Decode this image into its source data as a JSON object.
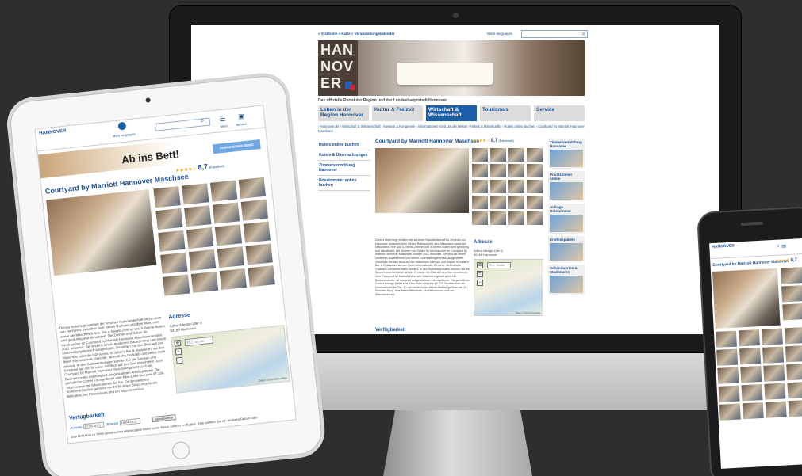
{
  "site": {
    "nav_links": "» Startseite  » Karte  » Veranstaltungskalender",
    "languages": "More languages",
    "logo_word": "HANNOVER",
    "tagline": "Das offizielle Portal der Region und der Landeshauptstadt Hannover",
    "menu": [
      {
        "label": "Leben in der Region Hannover",
        "active": false
      },
      {
        "label": "Kultur & Freizeit",
        "active": false
      },
      {
        "label": "Wirtschaft & Wissenschaft",
        "active": true
      },
      {
        "label": "Tourismus",
        "active": false
      },
      {
        "label": "Service",
        "active": false
      }
    ],
    "breadcrumb": "› Hannover.de  › Wirtschaft & Wissenschaft  › Messen & Kongresse  › Informationen rund um die Messe  › Hotels & Unterkünfte  › Hotels online buchen  › Courtyard by Marriott Hannover Maschsee",
    "sidebar": [
      "Hotels online buchen",
      "Hotels & Übernachtungen",
      "Zimmervermittlung Hannover",
      "Privatzimmer online buchen"
    ],
    "hotel_title": "Courtyard by Marriott Hannover Maschsee",
    "rating_stars": "★★★★☆",
    "rating_score": "8,7",
    "rating_note": "(Fabelhaft)",
    "description": "Dieses Hotel liegt inmitten der schönen Naturlandschaft im Zentrum von Hannover, zwischen dem Neuen Rathaus und dem Maschsee sowie am Maschteich-See. Die 4-Sterne-Zimmer und 5-Sterne-Suiten sind geräumig und klimatisiert. Die Zimmer und Suiten für Nichtraucher im Courtyard by Marriott Hannover Maschsee wurden 2012 renoviert. Sie sind mit einem modernen Badezimmer und einem Unterhaltungsbereich ausgestattet. Genießen Sie den Blick auf den Maschsee oder die HDI-Arena. In Julian's Bar & Restaurant werden Ihnen internationale Gerichte, farbenfrohe Cocktails und vieles mehr serviert. In den Sommermonaten können Sie die Speisen und Getränke auf der Terrasse mit Blick auf den See einnehmen. Zum Courtyard by Marriott Hannover Maschsee gehört auch ein Businesscenter mit komplett ausgestatteten Arbeitsplätzen. Die gemütliche Corner Lounge bietet eine Kino-Ecke und eine 67-Zoll-Touchscreen mit Informationen für Sie. Zu den weiteren Annehmlichkeiten gehören ein 24-Stunden-Shop, eine kleine Bibliothek, ein Fitnessraum und ein Wäscheservice.",
    "address_title": "Adresse",
    "address_line1": "Arthur-Menge-Ufer 3",
    "address_line2": "30169 Hannover",
    "map_search_placeholder": "PLZ, Straße",
    "map_credit": "Daten ©OpenStreetMap",
    "availability_title": "Verfügbarkeit",
    "right_boxes": [
      "Zimmervermittlung Hannover",
      "Privatzimmer online",
      "Anfrage Hotelzimmer",
      "Erlebnispakete",
      "Sehenswertes & Stadttouren"
    ]
  },
  "tablet": {
    "logo": "HANNOVER",
    "languages": "More languages",
    "menu_label": "Menü",
    "user_label": "Service",
    "banner_text": "Ab ins Bett!",
    "banner_button": "HANNOVERERLEBNIS",
    "hotel_title": "Courtyard by Marriott Hannover Maschsee",
    "rating_stars": "★★★★☆",
    "rating_score": "8,7",
    "rating_note": "(Fabelhaft)",
    "description": "Dieses Hotel liegt inmitten der schönen Naturlandschaft im Zentrum von Hannover, zwischen dem Neuen Rathaus und dem Maschsee sowie am Maschteich-See. Die 4-Sterne-Zimmer und 5-Sterne-Suiten sind geräumig und klimatisiert. Die Zimmer und Suiten für Nichtraucher im Courtyard by Marriott Hannover Maschsee wurden 2012 renoviert. Sie sind mit einem modernen Badezimmer und einem Unterhaltungsbereich ausgestattet. Genießen Sie den Blick auf den Maschsee oder die HDI-Arena. In Julian's Bar & Restaurant werden Ihnen internationale Gerichte, farbenfrohe Cocktails und vieles mehr serviert. In den Sommermonaten können Sie die Speisen und Getränke auf der Terrasse mit Blick auf den See einnehmen. Zum Courtyard by Marriott Hannover Maschsee gehört auch ein Businesscenter mit komplett ausgestatteten Arbeitsplätzen. Die gemütliche Corner Lounge bietet eine Kino-Ecke und eine 67-Zoll-Touchscreen mit Informationen für Sie. Zu den weiteren Annehmlichkeiten gehören ein 24-Stunden-Shop, eine kleine Bibliothek, ein Fitnessraum und ein Wäscheservice.",
    "address_title": "Adresse",
    "address_line1": "Arthur-Menge-Ufer 3",
    "address_line2": "30169 Hannover",
    "map_search_placeholder": "PLZ, Straße",
    "map_credit": "Daten ©OpenStreetMap",
    "availability_title": "Verfügbarkeit",
    "arrival_label": "Anreise",
    "arrival_value": "17.04.2013",
    "departure_label": "Abreise",
    "departure_value": "18.04.2013",
    "update_button": "aktualisieren",
    "availability_note": "Das Hotel hat zu Ihren gewünschten Reisedaten leider keine freien Zimmer verfügbar. Bitte wählen Sie ein anderes Datum oder"
  },
  "phone": {
    "logo": "HANNOVER",
    "hotel_title": "Courtyard by Marriott Hannover Maschsee",
    "rating_stars": "★★★★",
    "rating_score": "8,7"
  }
}
